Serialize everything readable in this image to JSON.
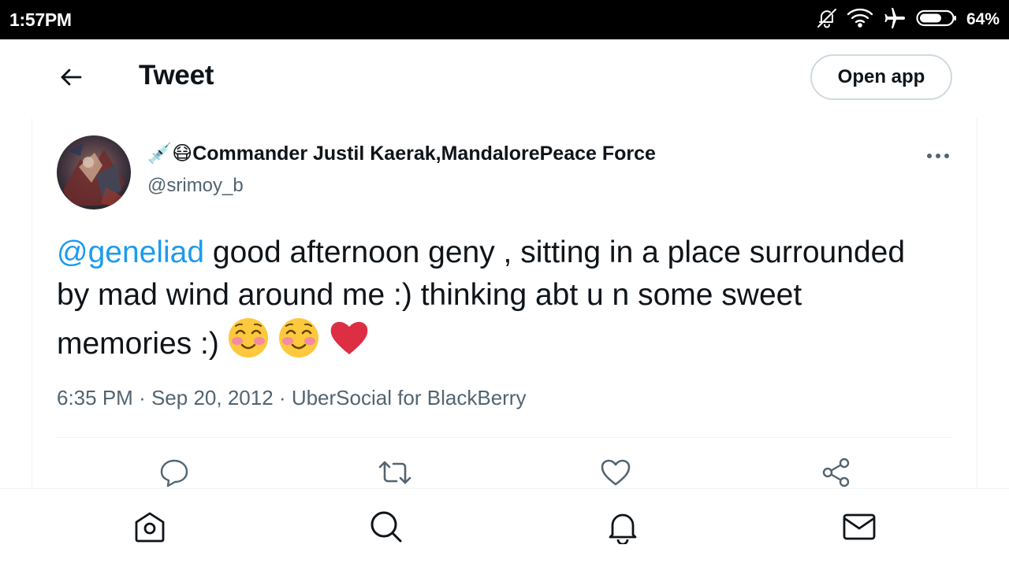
{
  "status_bar": {
    "time": "1:57PM",
    "battery_percent": "64%",
    "icons": [
      "bell-off-icon",
      "wifi-icon",
      "airplane-icon",
      "battery-icon"
    ]
  },
  "header": {
    "title": "Tweet",
    "back_icon": "arrow-left-icon",
    "open_app_label": "Open app"
  },
  "tweet": {
    "author": {
      "name_emoji_1": "💉",
      "name_emoji_2": "😷",
      "display_name": "Commander Justil Kaerak,MandalorePeace Force",
      "handle": "@srimoy_b"
    },
    "text_mention": "@geneliad",
    "text_body": " good afternoon geny , sitting in a place surrounded by mad wind around me :) thinking abt u n some sweet memories :)",
    "emojis": [
      "☺️",
      "☺️",
      "❤️"
    ],
    "time": "6:35 PM",
    "date": "Sep 20, 2012",
    "source": "UberSocial for BlackBerry",
    "separator": "·"
  },
  "actions": [
    "reply-icon",
    "retweet-icon",
    "like-icon",
    "share-icon"
  ],
  "bottom_nav": [
    "home-icon",
    "search-icon",
    "notifications-icon",
    "messages-icon"
  ],
  "colors": {
    "link": "#1d9bf0",
    "secondary_text": "#536471",
    "border": "#eff3f4",
    "status_bar_bg": "#000000"
  }
}
